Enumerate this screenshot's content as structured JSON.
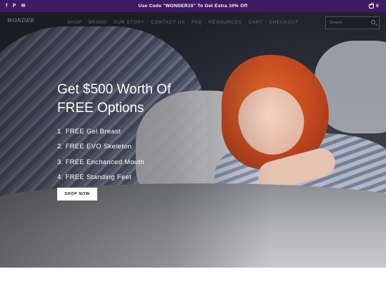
{
  "announcement": {
    "text": "Use Code \"WONDER10\" To Get Extra 10% Off",
    "cart_count": "0",
    "social_icons": [
      "facebook-icon",
      "pinterest-icon",
      "email-icon"
    ],
    "social_glyphs": [
      "f",
      "P",
      "✉"
    ]
  },
  "header": {
    "logo_text": "WONDER",
    "menu": [
      "SHOP",
      "BRAND",
      "OUR STORY",
      "CONTACT US",
      "FAQ",
      "RESOURCES",
      "CART",
      "CHECKOUT"
    ],
    "search_placeholder": "Search"
  },
  "hero": {
    "headline_line1": "Get $500 Worth Of",
    "headline_line2": "FREE Options",
    "features": [
      "1. FREE Gel Breast",
      "2. FREE EVO Skeleton",
      "3. FREE Enchanced Mouth",
      "4. FREE Standing Feet"
    ],
    "cta_label": "SHOP NOW"
  },
  "colors": {
    "announcement_bg": "#3d1a63",
    "cta_bg": "#ffffff"
  }
}
